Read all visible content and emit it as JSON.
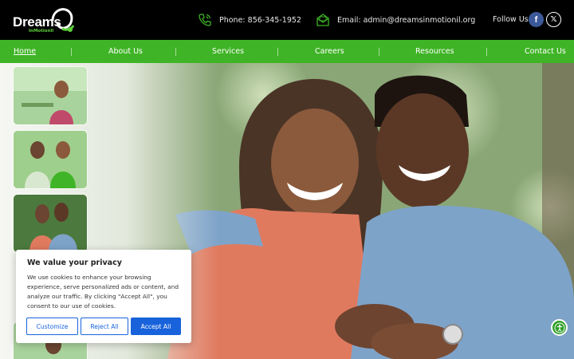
{
  "header": {
    "logo": {
      "word": "Dreams",
      "sub": "InMotionll"
    },
    "phone": {
      "text": "Phone: 856-345-1952",
      "icon": "phone-icon"
    },
    "email": {
      "text": "Email: admin@dreamsinmotionil.org",
      "icon": "mail-icon"
    },
    "follow_label": "Follow Us",
    "social": [
      {
        "name": "facebook",
        "glyph": "f"
      },
      {
        "name": "x-twitter",
        "glyph": "𝕏"
      }
    ]
  },
  "nav": {
    "items": [
      {
        "label": "Home",
        "active": true
      },
      {
        "label": "About Us",
        "active": false
      },
      {
        "label": "Services",
        "active": false
      },
      {
        "label": "Careers",
        "active": false
      },
      {
        "label": "Resources",
        "active": false
      },
      {
        "label": "Contact Us",
        "active": false
      }
    ]
  },
  "hero": {
    "thumbnails": [
      "thumbnail-1",
      "thumbnail-2",
      "thumbnail-3",
      "thumbnail-4"
    ]
  },
  "cookie_banner": {
    "title": "We value your privacy",
    "body": "We use cookies to enhance your browsing experience, serve personalized ads or content, and analyze our traffic. By clicking \"Accept All\", you consent to our use of cookies.",
    "customize": "Customize",
    "reject": "Reject All",
    "accept": "Accept All"
  },
  "colors": {
    "brand_green": "#3fb426",
    "header_bg": "#000000",
    "cookie_blue": "#1863dc"
  }
}
